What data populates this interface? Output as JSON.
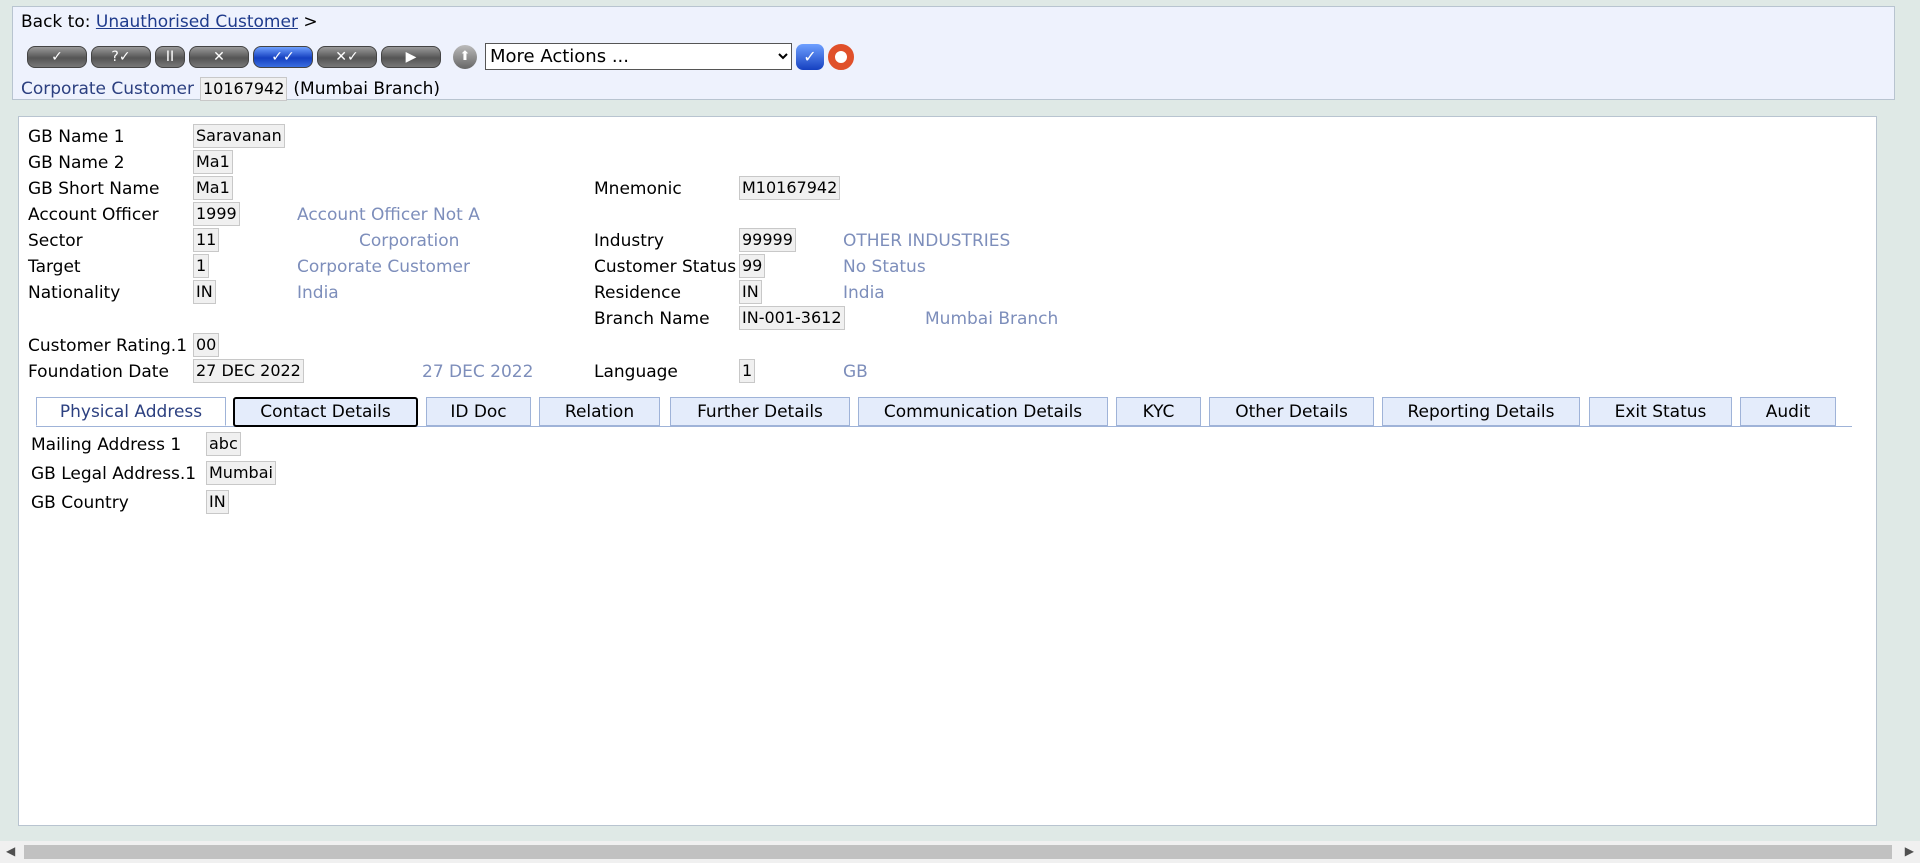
{
  "header": {
    "back_label": "Back to:",
    "back_link": "Unauthorised Customer",
    "back_sep": ">",
    "toolbar": [
      {
        "name": "commit",
        "glyph": "✓"
      },
      {
        "name": "validate",
        "glyph": "?✓"
      },
      {
        "name": "hold",
        "glyph": "II"
      },
      {
        "name": "delete",
        "glyph": "✕"
      },
      {
        "name": "authorise",
        "glyph": "✓✓"
      },
      {
        "name": "reverse",
        "glyph": "✕✓"
      },
      {
        "name": "next",
        "glyph": "▶"
      }
    ],
    "upload_glyph": "⬆",
    "more_actions": "More Actions ...",
    "go_glyph": "✓",
    "record_type": "Corporate Customer",
    "record_id": "10167942",
    "branch": "(Mumbai Branch)"
  },
  "form": {
    "gb_name1": {
      "label": "GB Name 1",
      "value": "Saravanan"
    },
    "gb_name2": {
      "label": "GB Name 2",
      "value": "Ma1"
    },
    "short_name": {
      "label": "GB Short Name",
      "value": "Ma1"
    },
    "mnemonic": {
      "label": "Mnemonic",
      "value": "M10167942"
    },
    "account_officer": {
      "label": "Account Officer",
      "value": "1999",
      "enrichment": "Account Officer Not A"
    },
    "sector": {
      "label": "Sector",
      "value": "11",
      "enrichment": "Corporation"
    },
    "industry": {
      "label": "Industry",
      "value": "99999",
      "enrichment": "OTHER INDUSTRIES"
    },
    "target": {
      "label": "Target",
      "value": "1",
      "enrichment": "Corporate Customer"
    },
    "customer_status": {
      "label": "Customer Status",
      "value": "99",
      "enrichment": "No Status"
    },
    "nationality": {
      "label": "Nationality",
      "value": "IN",
      "enrichment": "India"
    },
    "residence": {
      "label": "Residence",
      "value": "IN",
      "enrichment": "India"
    },
    "branch_name": {
      "label": "Branch Name",
      "value": "IN-001-3612",
      "enrichment": "Mumbai Branch"
    },
    "customer_rating": {
      "label": "Customer Rating.1",
      "value": "00"
    },
    "foundation_date": {
      "label": "Foundation Date",
      "value": "27 DEC 2022",
      "enrichment": "27 DEC 2022"
    },
    "language": {
      "label": "Language",
      "value": "1",
      "enrichment": "GB"
    }
  },
  "tabs": [
    "Physical Address",
    "Contact Details",
    "ID Doc",
    "Relation",
    "Further Details",
    "Communication Details",
    "KYC",
    "Other Details",
    "Reporting Details",
    "Exit Status",
    "Audit"
  ],
  "address": {
    "mailing": {
      "label": "Mailing Address 1",
      "value": "abc"
    },
    "legal": {
      "label": "GB Legal Address.1",
      "value": "Mumbai"
    },
    "country": {
      "label": "GB Country",
      "value": "IN"
    }
  },
  "scroll": {
    "left": "◀",
    "right": "▶"
  }
}
